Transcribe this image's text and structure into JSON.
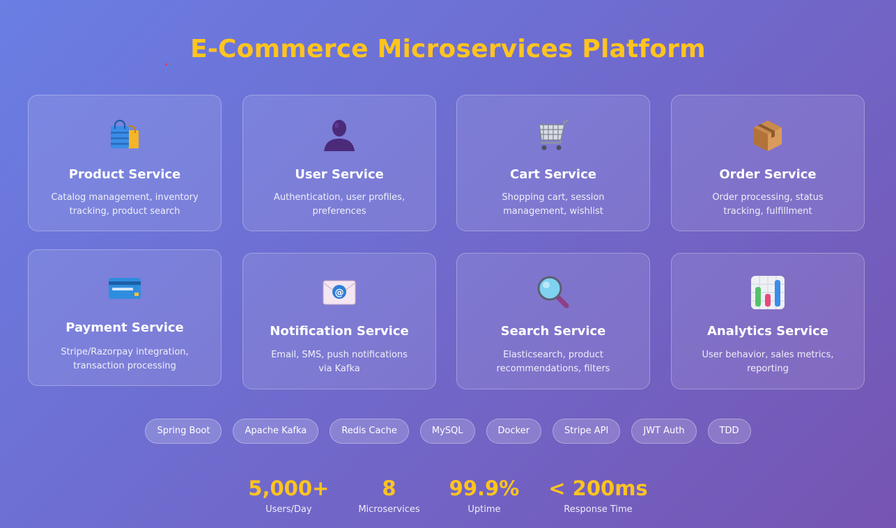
{
  "title": "E-Commerce Microservices Platform",
  "services": [
    {
      "name": "Product Service",
      "desc": "Catalog management, inventory tracking, product search",
      "icon": "shopping-bags-icon"
    },
    {
      "name": "User Service",
      "desc": "Authentication, user profiles, preferences",
      "icon": "user-silhouette-icon"
    },
    {
      "name": "Cart Service",
      "desc": "Shopping cart, session management, wishlist",
      "icon": "shopping-cart-icon"
    },
    {
      "name": "Order Service",
      "desc": "Order processing, status tracking, fulfillment",
      "icon": "package-icon"
    },
    {
      "name": "Payment Service",
      "desc": "Stripe/Razorpay integration, transaction processing",
      "icon": "credit-card-icon"
    },
    {
      "name": "Notification Service",
      "desc": "Email, SMS, push notifications via Kafka",
      "icon": "email-icon"
    },
    {
      "name": "Search Service",
      "desc": "Elasticsearch, product recommendations, filters",
      "icon": "magnifying-glass-icon"
    },
    {
      "name": "Analytics Service",
      "desc": "User behavior, sales metrics, reporting",
      "icon": "bar-chart-icon"
    }
  ],
  "tech": [
    "Spring Boot",
    "Apache Kafka",
    "Redis Cache",
    "MySQL",
    "Docker",
    "Stripe API",
    "JWT Auth",
    "TDD"
  ],
  "stats": [
    {
      "value": "5,000+",
      "label": "Users/Day"
    },
    {
      "value": "8",
      "label": "Microservices"
    },
    {
      "value": "99.9%",
      "label": "Uptime"
    },
    {
      "value": "< 200ms",
      "label": "Response Time"
    }
  ],
  "colors": {
    "accent": "#ffc41f",
    "bg_start": "#6a7ee3",
    "bg_end": "#7654b2"
  }
}
